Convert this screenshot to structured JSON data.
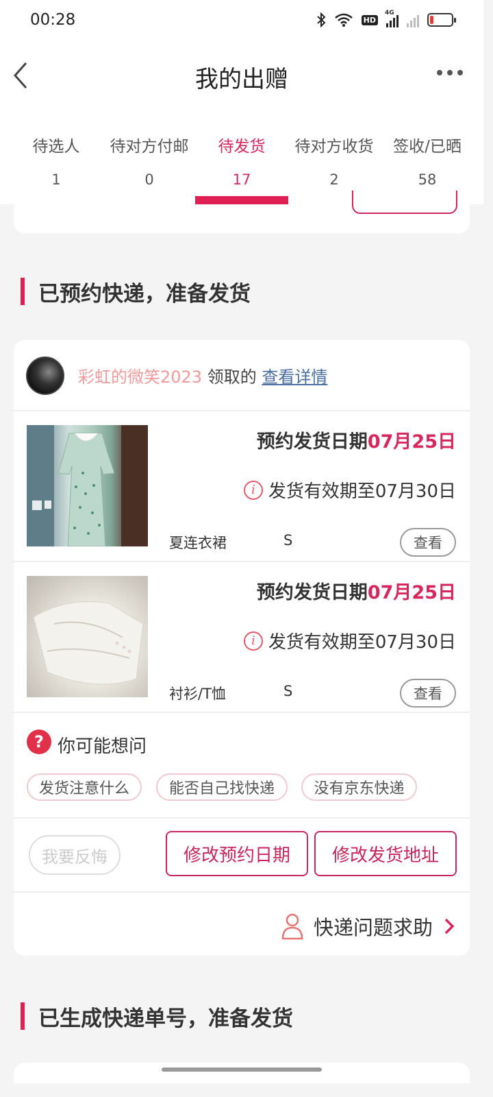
{
  "status_bar": {
    "time": "00:28",
    "network": "4G",
    "hd_label": "HD",
    "battery_level": 0.15
  },
  "header": {
    "title": "我的出赠"
  },
  "tabs": [
    {
      "label": "待选人",
      "count": "1"
    },
    {
      "label": "待对方付邮",
      "count": "0"
    },
    {
      "label": "待发货",
      "count": "17",
      "active": true
    },
    {
      "label": "待对方收货",
      "count": "2"
    },
    {
      "label": "签收/已晒",
      "count": "58"
    }
  ],
  "section1": {
    "title": "已预约快递，准备发货"
  },
  "order": {
    "receiver": "彩虹的微笑2023",
    "claim_text": "领取的",
    "detail_link": "查看详情",
    "items": [
      {
        "schedule_label": "预约发货日期",
        "schedule_date": "07月25日",
        "validity": "发货有效期至07月30日",
        "category": "夏连衣裙",
        "size": "S",
        "view_label": "查看"
      },
      {
        "schedule_label": "预约发货日期",
        "schedule_date": "07月25日",
        "validity": "发货有效期至07月30日",
        "category": "衬衫/T恤",
        "size": "S",
        "view_label": "查看"
      }
    ],
    "faq": {
      "title": "你可能想问",
      "chips": [
        "发货注意什么",
        "能否自己找快递",
        "没有京东快递"
      ]
    },
    "actions": {
      "regret": "我要反悔",
      "change_date": "修改预约日期",
      "change_address": "修改发货地址"
    },
    "help": "快递问题求助"
  },
  "section2": {
    "title": "已生成快递单号，准备发货"
  },
  "colors": {
    "accent": "#d6275d",
    "link": "#4a6e9e",
    "receiver": "#ef9a9a",
    "background": "#f4f4f4"
  }
}
